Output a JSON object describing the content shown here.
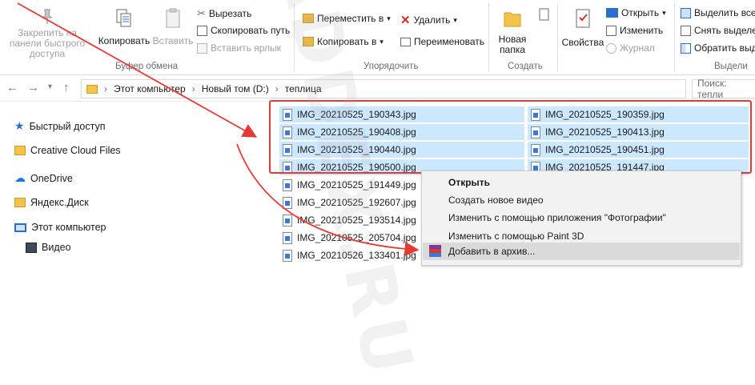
{
  "ribbon": {
    "clipboard": {
      "pin_label": "Закрепить на панели быстрого доступа",
      "copy_label": "Копировать",
      "paste_label": "Вставить",
      "cut_label": "Вырезать",
      "copy_path_label": "Скопировать путь",
      "paste_shortcut_label": "Вставить ярлык",
      "group_label": "Буфер обмена"
    },
    "organize": {
      "move_to_label": "Переместить в",
      "copy_to_label": "Копировать в",
      "delete_label": "Удалить",
      "rename_label": "Переименовать",
      "group_label": "Упорядочить"
    },
    "create": {
      "new_folder_label": "Новая папка",
      "group_label": "Создать"
    },
    "open": {
      "properties_label": "Свойства",
      "open_label": "Открыть",
      "edit_label": "Изменить",
      "history_label": "Журнал"
    },
    "select": {
      "select_all_label": "Выделить все",
      "deselect_label": "Снять выделе",
      "invert_label": "Обратить выд",
      "group_label": "Выдели"
    }
  },
  "address": {
    "crumbs": [
      "Этот компьютер",
      "Новый том (D:)",
      "теплица"
    ],
    "search_placeholder": "Поиск: тепли"
  },
  "nav": {
    "items": [
      "Быстрый доступ",
      "Creative Cloud Files",
      "OneDrive",
      "Яндекс.Диск",
      "Этот компьютер",
      "Видео"
    ]
  },
  "files": {
    "col1": [
      "IMG_20210525_190343.jpg",
      "IMG_20210525_190408.jpg",
      "IMG_20210525_190440.jpg",
      "IMG_20210525_190500.jpg",
      "IMG_20210525_191449.jpg",
      "IMG_20210525_192607.jpg",
      "IMG_20210525_193514.jpg",
      "IMG_20210525_205704.jpg",
      "IMG_20210526_133401.jpg"
    ],
    "col2": [
      "IMG_20210525_190359.jpg",
      "IMG_20210525_190413.jpg",
      "IMG_20210525_190451.jpg",
      "IMG_20210525_191447.jpg"
    ]
  },
  "context_menu": {
    "items": [
      "Открыть",
      "Создать новое видео",
      "Изменить с помощью приложения \"Фотографии\"",
      "Изменить с помощью Paint 3D",
      "Добавить в архив..."
    ]
  },
  "watermark": "MADDEX.RU",
  "colors": {
    "selection": "#cce8ff",
    "annotation_red": "#e53935",
    "accent": "#3b78d8"
  }
}
